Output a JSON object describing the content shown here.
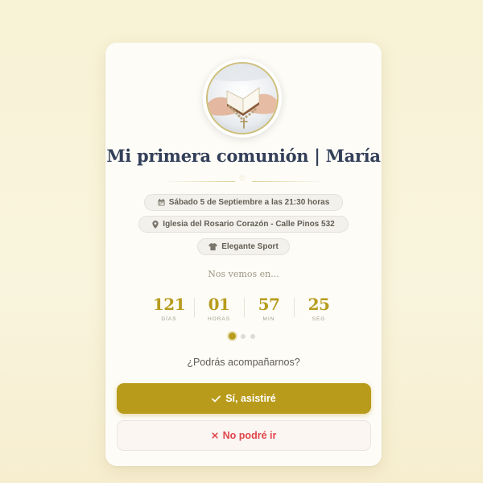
{
  "invitation": {
    "photo_alt": "Manos sosteniendo un libro de oración con rosario",
    "title": "Mi primera comunión | María",
    "divider_glyph": "♡",
    "details": {
      "date": "Sábado 5 de Septiembre a las 21:30 horas",
      "place": "Iglesia del Rosario Corazón - Calle Pinos 532",
      "dress_code": "Elegante Sport"
    },
    "countdown_intro": "Nos vemos en...",
    "countdown": [
      {
        "value": "121",
        "label": "DÍAS"
      },
      {
        "value": "01",
        "label": "HORAS"
      },
      {
        "value": "57",
        "label": "MIN"
      },
      {
        "value": "25",
        "label": "SEG"
      }
    ],
    "carousel": {
      "pages": 3,
      "active": 1
    },
    "rsvp": {
      "question": "¿Podrás acompañarnos?",
      "yes_label": "Sí, asistiré",
      "no_label": "No podré ir"
    }
  },
  "colors": {
    "background": "#f8f2d6",
    "card": "#fdfcf7",
    "title": "#34405a",
    "accent_gold": "#b99b1b",
    "decline_red": "#e0444a",
    "pill_bg": "#f3f1eb"
  },
  "icons": {
    "date": "calendar-icon",
    "place": "map-pin-icon",
    "dress_code": "shirt-icon",
    "yes": "check-icon",
    "no": "close-icon"
  }
}
